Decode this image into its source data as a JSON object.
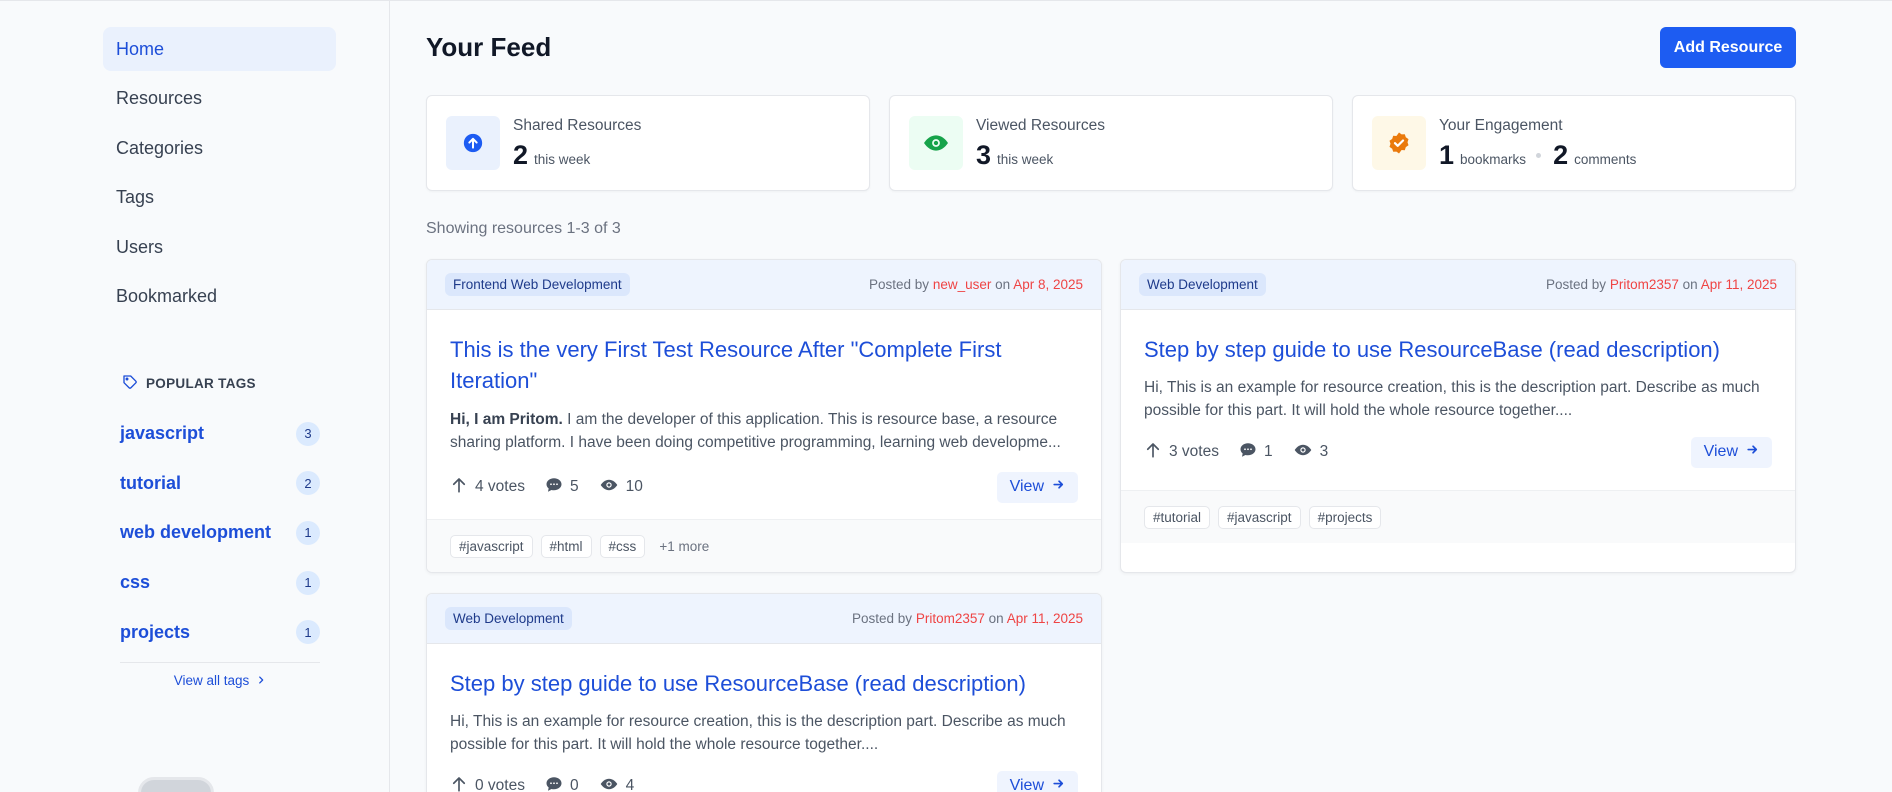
{
  "sidebar": {
    "nav": [
      {
        "label": "Home",
        "active": true
      },
      {
        "label": "Resources"
      },
      {
        "label": "Categories"
      },
      {
        "label": "Tags"
      },
      {
        "label": "Users"
      },
      {
        "label": "Bookmarked"
      }
    ],
    "popular_tags_title": "POPULAR TAGS",
    "popular_tags": [
      {
        "name": "javascript",
        "count": "3"
      },
      {
        "name": "tutorial",
        "count": "2"
      },
      {
        "name": "web development",
        "count": "1"
      },
      {
        "name": "css",
        "count": "1"
      },
      {
        "name": "projects",
        "count": "1"
      }
    ],
    "view_all_tags": "View all tags"
  },
  "header": {
    "title": "Your Feed",
    "add_button": "Add Resource"
  },
  "stats": {
    "shared": {
      "label": "Shared Resources",
      "value": "2",
      "unit": "this week"
    },
    "viewed": {
      "label": "Viewed Resources",
      "value": "3",
      "unit": "this week"
    },
    "engagement": {
      "label": "Your Engagement",
      "bookmarks": "1",
      "bookmarks_unit": "bookmarks",
      "comments": "2",
      "comments_unit": "comments"
    }
  },
  "showing_text": "Showing resources 1-3 of 3",
  "cards": [
    {
      "category": "Frontend Web Development",
      "posted_by": "Posted by",
      "user": "new_user",
      "on": "on",
      "date": "Apr 8, 2025",
      "title": "This is the very First Test Resource After \"Complete First Iteration\"",
      "desc_bold": "Hi, I am Pritom.",
      "desc": " I am the developer of this application. This is resource base, a resource sharing platform. I have been doing competitive programming, learning web developme...",
      "votes": "4 votes",
      "comments": "5",
      "views": "10",
      "view_label": "View",
      "tags": [
        "#javascript",
        "#html",
        "#css"
      ],
      "more": "+1 more"
    },
    {
      "category": "Web Development",
      "posted_by": "Posted by",
      "user": "Pritom2357",
      "on": "on",
      "date": "Apr 11, 2025",
      "title": "Step by step guide to use ResourceBase (read description)",
      "desc": "Hi, This is an example for resource creation, this is the description part. Describe as much possible for this part. It will hold the whole  resource together....",
      "votes": "3 votes",
      "comments": "1",
      "views": "3",
      "view_label": "View",
      "tags": [
        "#tutorial",
        "#javascript",
        "#projects"
      ]
    },
    {
      "category": "Web Development",
      "posted_by": "Posted by",
      "user": "Pritom2357",
      "on": "on",
      "date": "Apr 11, 2025",
      "title": "Step by step guide to use ResourceBase (read description)",
      "desc": "Hi, This is an example for resource creation, this is the description part. Describe as much possible for this part. It will hold the whole  resource together....",
      "votes": "0 votes",
      "comments": "0",
      "views": "4",
      "view_label": "View"
    }
  ]
}
